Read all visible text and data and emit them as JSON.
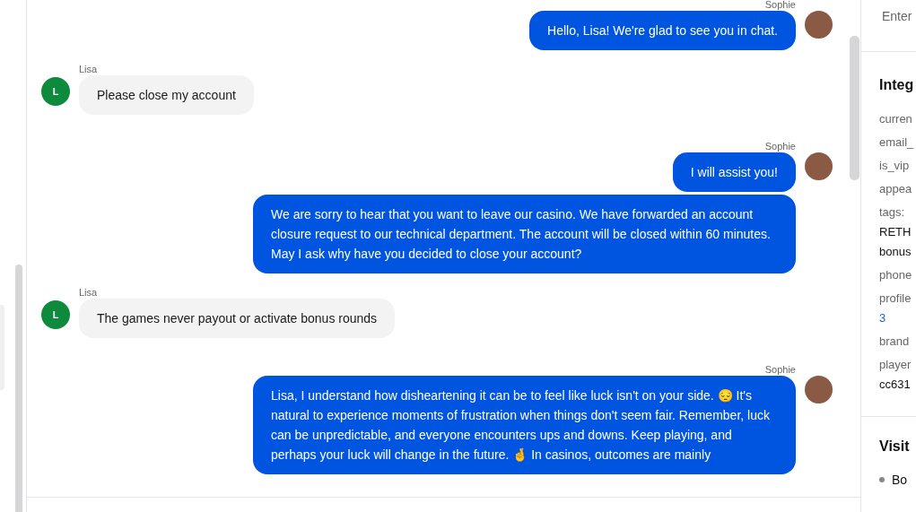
{
  "chat": {
    "groups": [
      {
        "kind": "agent",
        "sender": "Sophie",
        "bubbles": [
          "Hello, Lisa! We're glad to see you in chat."
        ]
      },
      {
        "kind": "visitor",
        "sender": "Lisa",
        "initial": "L",
        "bubbles": [
          "Please close my account"
        ]
      },
      {
        "kind": "agent",
        "sender": "Sophie",
        "bubbles": [
          "I will assist you!",
          "We are sorry to hear that you want to leave our casino. We have forwarded an account closure request to our technical department. The account will be closed within 60 minutes. May I ask why have you decided to close your account?"
        ]
      },
      {
        "kind": "visitor",
        "sender": "Lisa",
        "initial": "L",
        "bubbles": [
          "The games never payout or activate bonus rounds"
        ]
      },
      {
        "kind": "agent",
        "sender": "Sophie",
        "bubbles": [
          "Lisa, I understand how disheartening it can be to feel like luck isn't on your side. 😔 It's natural to experience moments of frustration when things don't seem fair. Remember, luck can be unpredictable, and everyone encounters ups and downs. Keep playing, and perhaps your luck will change in the future. 🤞 In casinos, outcomes are mainly"
        ]
      }
    ]
  },
  "side_panel": {
    "search": {
      "placeholder": "Enter"
    },
    "integrations": {
      "title": "Integ",
      "fields": [
        {
          "kind": "label",
          "text": "curren"
        },
        {
          "kind": "label",
          "text": "email_"
        },
        {
          "kind": "label",
          "text": "is_vip"
        },
        {
          "kind": "label",
          "text": "appea"
        },
        {
          "kind": "label",
          "text": "tags:"
        },
        {
          "kind": "value",
          "text": "RETH"
        },
        {
          "kind": "value",
          "text": "bonus"
        },
        {
          "kind": "label",
          "text": "phone"
        },
        {
          "kind": "label",
          "text": "profile"
        },
        {
          "kind": "link",
          "text": "3"
        },
        {
          "kind": "label",
          "text": "brand"
        },
        {
          "kind": "label",
          "text": "player"
        },
        {
          "kind": "value",
          "text": "cc631"
        }
      ]
    },
    "visitor": {
      "title": "Visit",
      "items": [
        "Bo"
      ]
    }
  }
}
